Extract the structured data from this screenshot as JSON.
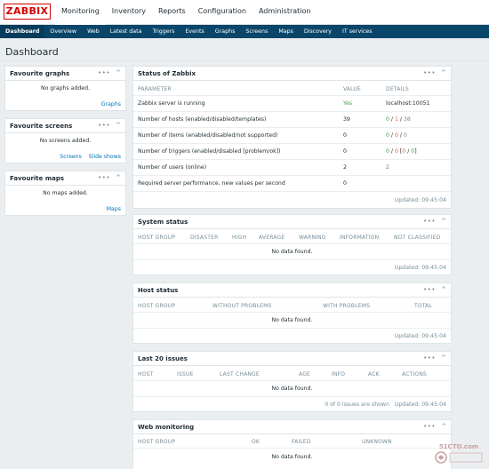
{
  "logo": "ZABBIX",
  "main_menu": [
    "Monitoring",
    "Inventory",
    "Reports",
    "Configuration",
    "Administration"
  ],
  "sub_menu": [
    "Dashboard",
    "Overview",
    "Web",
    "Latest data",
    "Triggers",
    "Events",
    "Graphs",
    "Screens",
    "Maps",
    "Discovery",
    "IT services"
  ],
  "page_title": "Dashboard",
  "fav_graphs": {
    "title": "Favourite graphs",
    "empty": "No graphs added.",
    "link1": "Graphs"
  },
  "fav_screens": {
    "title": "Favourite screens",
    "empty": "No screens added.",
    "link1": "Screens",
    "link2": "Slide shows"
  },
  "fav_maps": {
    "title": "Favourite maps",
    "empty": "No maps added.",
    "link1": "Maps"
  },
  "status": {
    "title": "Status of Zabbix",
    "headers": [
      "PARAMETER",
      "VALUE",
      "DETAILS"
    ],
    "rows": [
      {
        "param": "Zabbix server is running",
        "value": "Yes",
        "details": "localhost:10051"
      },
      {
        "param": "Number of hosts (enabled/disabled/templates)",
        "value": "39",
        "d1": "0",
        "d2": "1",
        "d3": "38"
      },
      {
        "param": "Number of items (enabled/disabled/not supported)",
        "value": "0",
        "d1": "0",
        "d2": "0",
        "d3": "0"
      },
      {
        "param": "Number of triggers (enabled/disabled [problem/ok])",
        "value": "0",
        "d1": "0",
        "d2": "0",
        "d3": "0",
        "d4": "0"
      },
      {
        "param": "Number of users (online)",
        "value": "2",
        "details": "2"
      },
      {
        "param": "Required server performance, new values per second",
        "value": "0",
        "details": ""
      }
    ],
    "updated": "Updated: 09:45:04"
  },
  "system_status": {
    "title": "System status",
    "headers": [
      "HOST GROUP",
      "DISASTER",
      "HIGH",
      "AVERAGE",
      "WARNING",
      "INFORMATION",
      "NOT CLASSIFIED"
    ],
    "empty": "No data found.",
    "updated": "Updated: 09:45:04"
  },
  "host_status": {
    "title": "Host status",
    "headers": [
      "HOST GROUP",
      "WITHOUT PROBLEMS",
      "WITH PROBLEMS",
      "TOTAL"
    ],
    "empty": "No data found.",
    "updated": "Updated: 09:45:04"
  },
  "last_issues": {
    "title": "Last 20 issues",
    "headers": [
      "HOST",
      "ISSUE",
      "LAST CHANGE",
      "AGE",
      "INFO",
      "ACK",
      "ACTIONS"
    ],
    "empty": "No data found.",
    "shown": "0 of 0 issues are shown",
    "updated": "Updated: 09:45:04"
  },
  "web_monitoring": {
    "title": "Web monitoring",
    "headers": [
      "HOST GROUP",
      "OK",
      "FAILED",
      "UNKNOWN"
    ],
    "empty": "No data found."
  },
  "widget_controls": {
    "menu": "•••",
    "collapse": "^"
  },
  "watermark_text": "51CTO.com",
  "colors": {
    "brand": "#d40000",
    "nav": "#0a466a",
    "link": "#0275b8",
    "ok": "#429e47",
    "problem": "#e45959"
  }
}
